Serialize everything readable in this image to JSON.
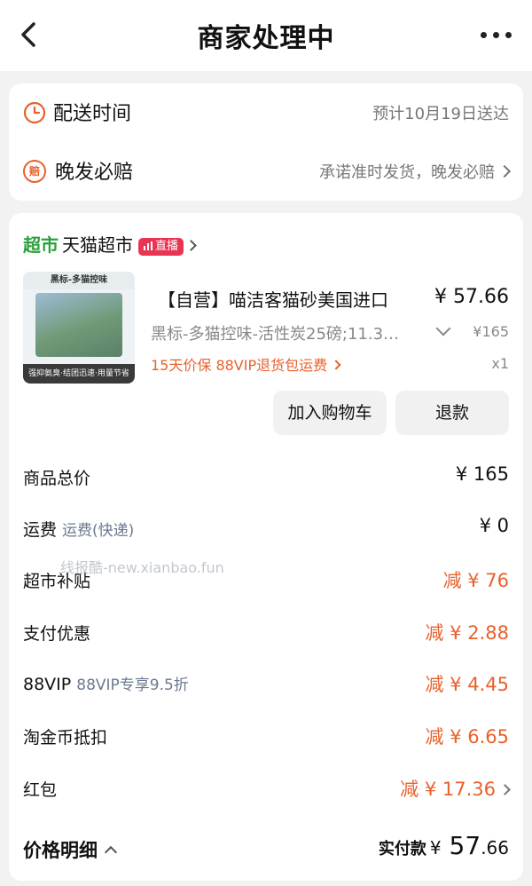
{
  "header": {
    "title": "商家处理中"
  },
  "delivery": {
    "label": "配送时间",
    "value": "预计10月19日送达"
  },
  "late_compensation": {
    "badge": "赔",
    "label": "晚发必赔",
    "value": "承诺准时发货，晚发必赔"
  },
  "store": {
    "super_label": "超市",
    "name": "天猫超市",
    "live_label": "直播"
  },
  "product": {
    "image_top_text": "黑标-多猫控味",
    "image_bottom_text": "强抑氨臭·结团迅速·用量节省",
    "title": "【自营】喵洁客猫砂美国进口",
    "price": "¥ 57.66",
    "spec": "黑标-多猫控味-活性炭25磅;11.3…",
    "original_price": "¥165",
    "service": "15天价保  88VIP退货包运费",
    "quantity": "x1"
  },
  "actions": {
    "add_cart": "加入购物车",
    "refund": "退款"
  },
  "watermark": "线报酷-new.xianbao.fun",
  "summary": [
    {
      "label": "商品总价",
      "sub": "",
      "value": "¥ 165",
      "orange": false
    },
    {
      "label": "运费",
      "sub": "运费(快递)",
      "value": "¥ 0",
      "orange": false
    },
    {
      "label": "超市补贴",
      "sub": "",
      "value": "减 ¥ 76",
      "orange": true
    },
    {
      "label": "支付优惠",
      "sub": "",
      "value": "减 ¥ 2.88",
      "orange": true
    },
    {
      "label": "88VIP",
      "sub": "88VIP专享9.5折",
      "value": "减 ¥ 4.45",
      "orange": true
    },
    {
      "label": "淘金币抵扣",
      "sub": "",
      "value": "减 ¥ 6.65",
      "orange": true
    },
    {
      "label": "红包",
      "sub": "",
      "value": "减 ¥ 17.36",
      "orange": true
    }
  ],
  "total": {
    "label": "价格明细",
    "pay_label": "实付款",
    "yen": "¥",
    "integer": "57",
    "cents": ".66"
  },
  "colors": {
    "accent_orange": "#e8612d",
    "tmall_green": "#2aa13c",
    "live_red": "#e83554"
  }
}
